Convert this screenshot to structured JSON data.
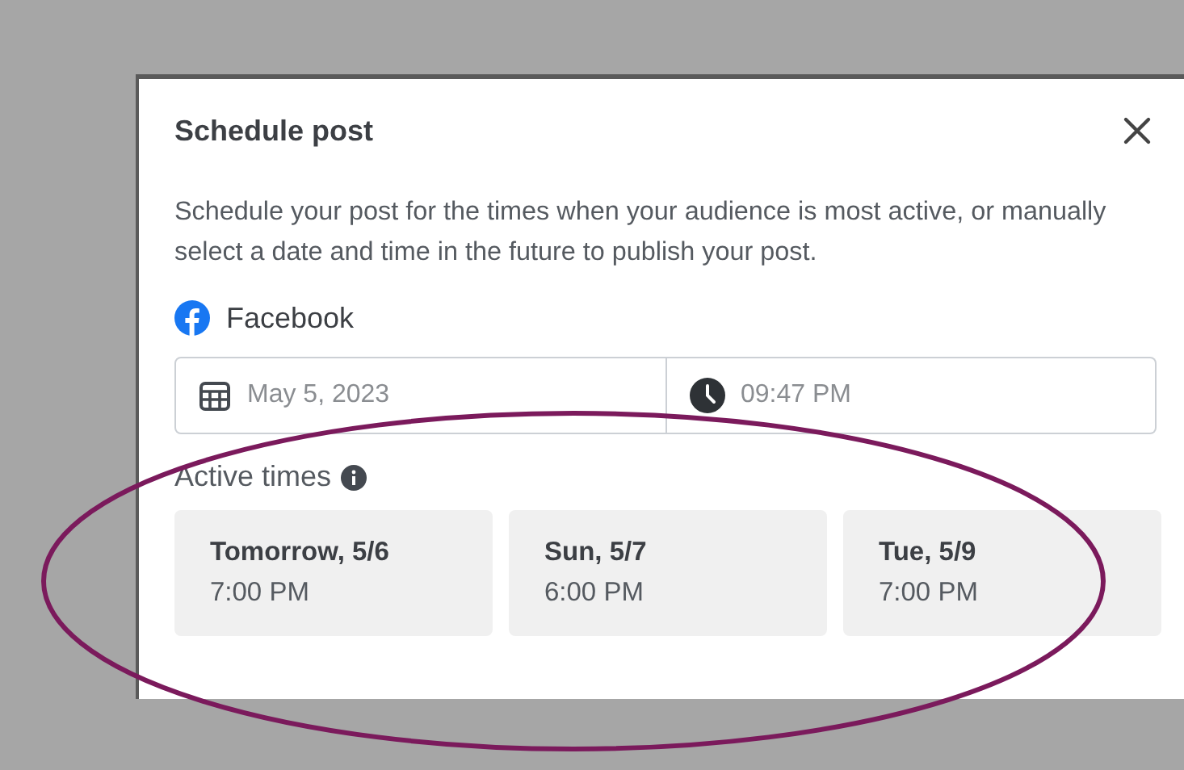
{
  "dialog": {
    "title": "Schedule post",
    "description": "Schedule your post for the times when your audience is most active, or manually select a date and time in the future to publish your post.",
    "platform": "Facebook",
    "date": "May 5, 2023",
    "time": "09:47 PM",
    "active_times_label": "Active times",
    "active_times": [
      {
        "day": "Tomorrow, 5/6",
        "time": "7:00 PM"
      },
      {
        "day": "Sun, 5/7",
        "time": "6:00 PM"
      },
      {
        "day": "Tue, 5/9",
        "time": "7:00 PM"
      }
    ]
  }
}
